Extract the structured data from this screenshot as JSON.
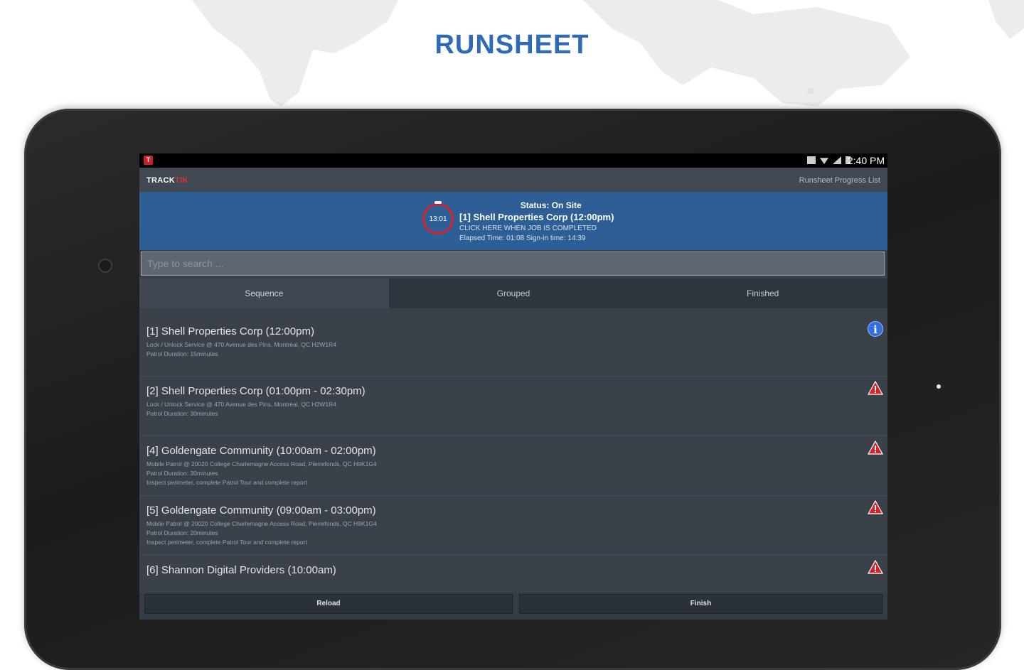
{
  "page": {
    "title": "RUNSHEET"
  },
  "status_bar": {
    "time": "2:40 PM"
  },
  "app_bar": {
    "logo_track": "TRACK",
    "logo_tik": "TIK",
    "menu_label": "Runsheet Progress List"
  },
  "banner": {
    "timer": "13:01",
    "status": "Status: On Site",
    "job": "[1] Shell Properties Corp (12:00pm)",
    "hint": "CLICK HERE WHEN JOB IS COMPLETED",
    "elapsed": "Elapsed Time: 01:08  Sign-in time: 14:39"
  },
  "search": {
    "placeholder": "Type to search ..."
  },
  "tabs": [
    {
      "label": "Sequence",
      "active": true
    },
    {
      "label": "Grouped",
      "active": false
    },
    {
      "label": "Finished",
      "active": false
    }
  ],
  "items": [
    {
      "title": "[1] Shell Properties Corp (12:00pm)",
      "detail1": "Lock / Unlock Service @ 470 Avenue des Pins, Montréal, QC H2W1R4",
      "detail2": "Patrol Duration: 15minutes",
      "detail3": "",
      "icon": "info-icon"
    },
    {
      "title": "[2] Shell Properties Corp (01:00pm - 02:30pm)",
      "detail1": "Lock / Unlock Service @ 470 Avenue des Pins, Montréal, QC H2W1R4",
      "detail2": "Patrol Duration: 30minutes",
      "detail3": "",
      "icon": "warning-icon"
    },
    {
      "title": "[4] Goldengate Community  (10:00am - 02:00pm)",
      "detail1": "Mobile Patrol @ 20020 College Charlemagne Access Road, Pierrefonds, QC H9K1G4",
      "detail2": "Patrol Duration: 30minutes",
      "detail3": "Inspect perimeter, complete Patrol Tour and complete report",
      "icon": "warning-icon"
    },
    {
      "title": "[5] Goldengate Community  (09:00am - 03:00pm)",
      "detail1": "Mobile Patrol @ 20020 College Charlemagne Access Road, Pierrefonds, QC H9K1G4",
      "detail2": "Patrol Duration: 20minutes",
      "detail3": "Inspect perimeter, complete Patrol Tour and complete report",
      "icon": "warning-icon"
    },
    {
      "title": "[6] Shannon Digital Providers (10:00am)",
      "detail1": "",
      "detail2": "",
      "detail3": "",
      "icon": "warning-icon"
    }
  ],
  "footer": {
    "reload_label": "Reload",
    "finish_label": "Finish"
  },
  "colors": {
    "title_blue": "#2e6ab5",
    "banner_blue": "#2d5f96",
    "screen_bg": "#3a4149",
    "alert_red": "#d8222b",
    "info_blue": "#2f6fe0"
  }
}
